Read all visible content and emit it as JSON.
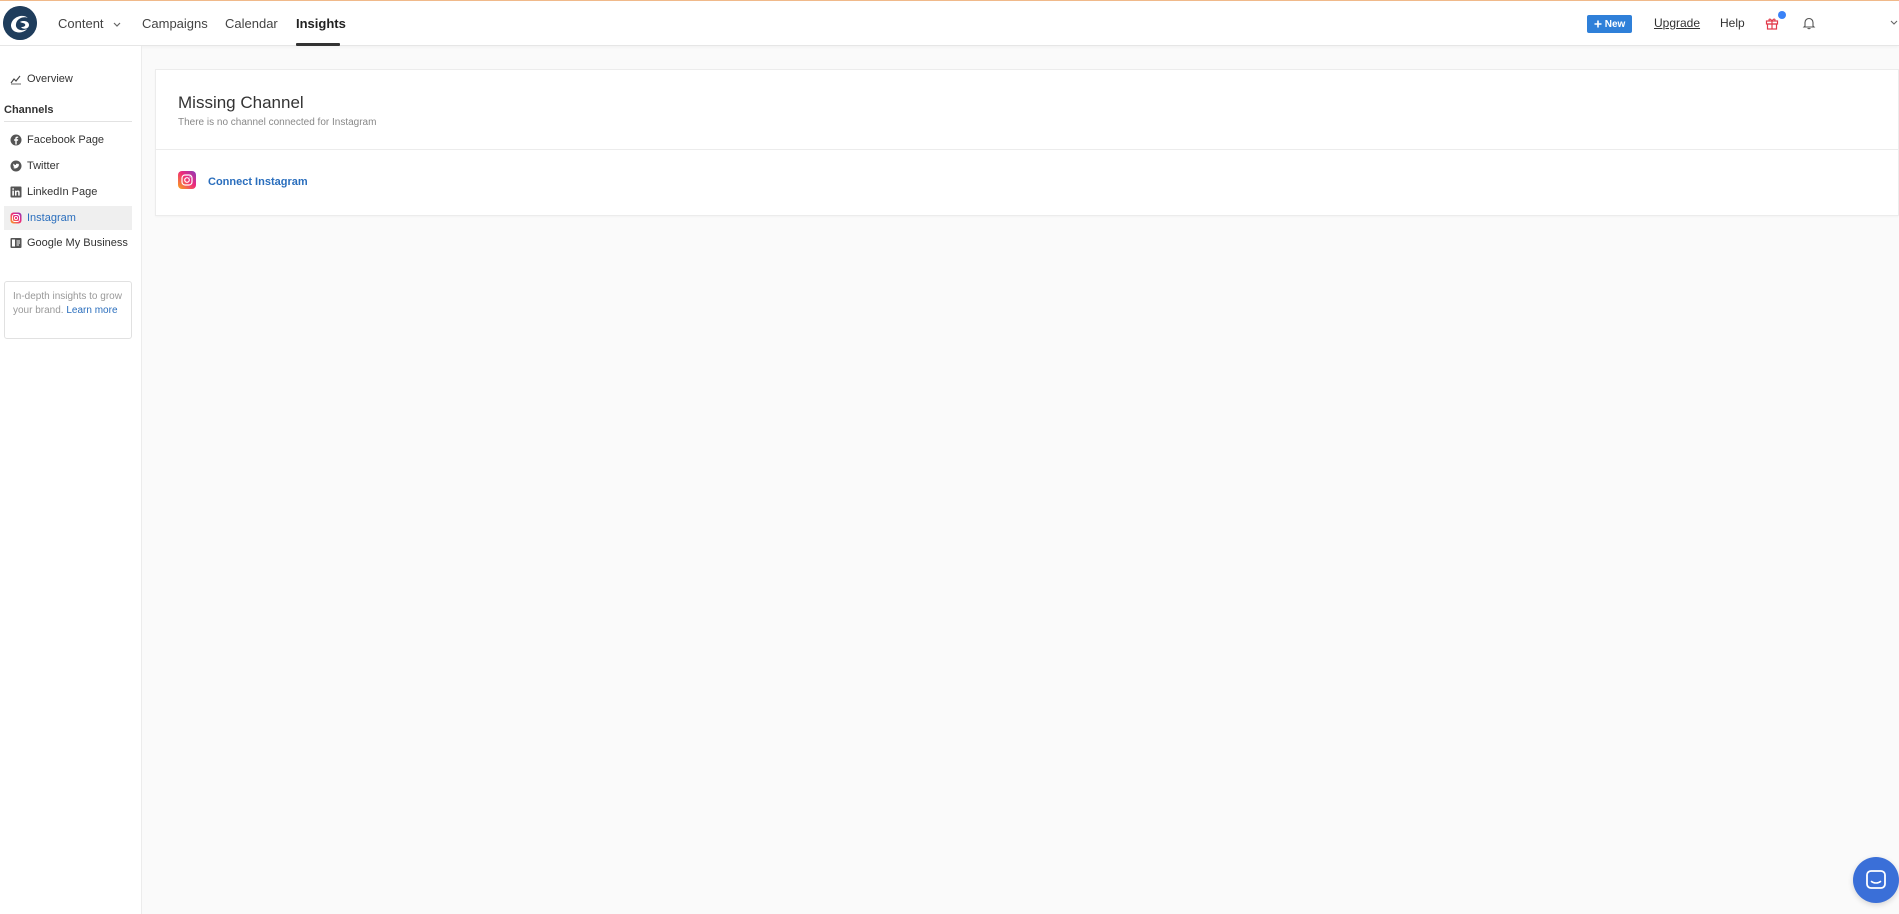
{
  "nav": {
    "content": "Content",
    "campaigns": "Campaigns",
    "calendar": "Calendar",
    "insights": "Insights"
  },
  "topright": {
    "new_label": "New",
    "upgrade": "Upgrade",
    "help": "Help"
  },
  "sidebar": {
    "overview": "Overview",
    "channels_heading": "Channels",
    "items": [
      {
        "label": "Facebook Page",
        "icon": "facebook-icon"
      },
      {
        "label": "Twitter",
        "icon": "twitter-icon"
      },
      {
        "label": "LinkedIn Page",
        "icon": "linkedin-icon"
      },
      {
        "label": "Instagram",
        "icon": "instagram-icon",
        "active": true
      },
      {
        "label": "Google My Business",
        "icon": "google-my-business-icon"
      }
    ],
    "promo_text": "In-depth insights to grow your brand.",
    "promo_link": "Learn more"
  },
  "card": {
    "title": "Missing Channel",
    "subtitle": "There is no channel connected for Instagram",
    "connect_label": "Connect Instagram"
  },
  "colors": {
    "accent": "#2f80d9",
    "link": "#2a6ebd",
    "top_border": "#f0b98a"
  }
}
